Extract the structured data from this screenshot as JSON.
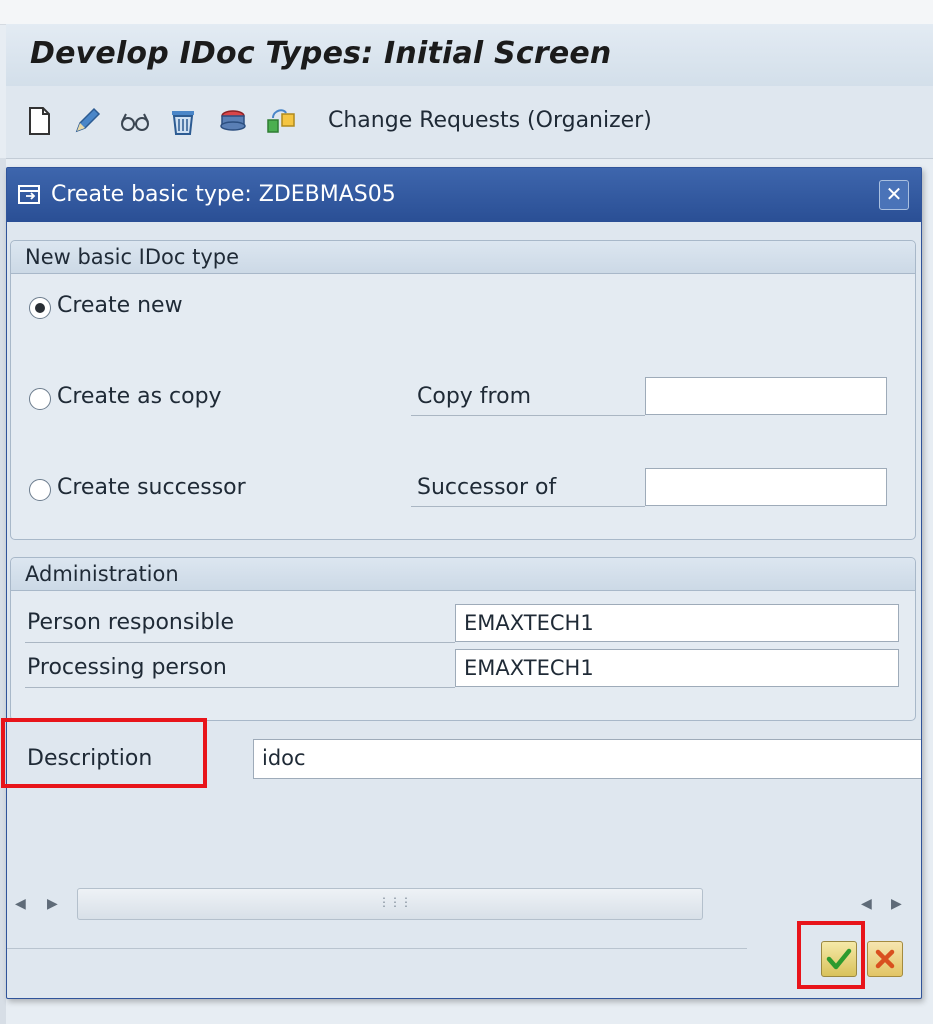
{
  "window": {
    "title": "Develop IDoc Types: Initial Screen"
  },
  "toolbar": {
    "icons": [
      "new-document-icon",
      "pencil-icon",
      "display-glasses-icon",
      "trash-icon",
      "transport-icon",
      "change-request-icon"
    ],
    "change_requests_label": "Change Requests (Organizer)"
  },
  "dialog": {
    "title": "Create basic type: ZDEBMAS05",
    "close_icon": "close-icon",
    "new_type_group": {
      "header": "New basic IDoc type",
      "options": [
        {
          "label": "Create new",
          "selected": true
        },
        {
          "label": "Create as copy",
          "selected": false
        },
        {
          "label": "Create successor",
          "selected": false
        }
      ],
      "copy_from_label": "Copy from",
      "copy_from_value": "",
      "successor_of_label": "Successor of",
      "successor_of_value": ""
    },
    "admin_group": {
      "header": "Administration",
      "person_responsible_label": "Person responsible",
      "person_responsible_value": "EMAXTECH1",
      "processing_person_label": "Processing person",
      "processing_person_value": "EMAXTECH1"
    },
    "description_label": "Description",
    "description_value": "idoc",
    "buttons": {
      "ok_icon": "checkmark-icon",
      "cancel_icon": "cancel-x-icon"
    }
  },
  "colors": {
    "dialog_title_bg": "#2a4f95",
    "highlight": "#e8141a"
  }
}
